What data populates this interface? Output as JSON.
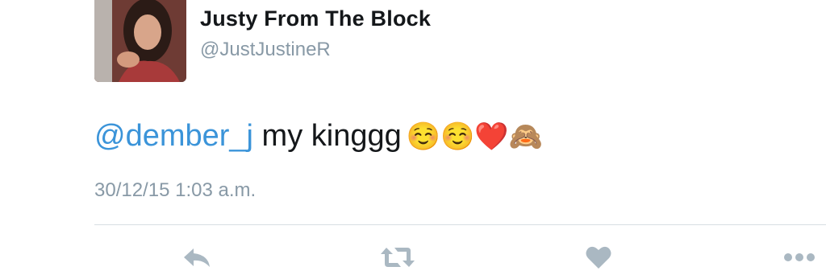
{
  "author": {
    "display_name": "Justy From The Block",
    "handle": "@JustJustineR"
  },
  "tweet": {
    "mention": "@dember_j",
    "text": " my kinggg",
    "emojis": "☺️☺️❤️🙈",
    "timestamp": "30/12/15 1:03 a.m."
  },
  "actions": {
    "icons": [
      "reply-icon",
      "retweet-icon",
      "like-icon",
      "more-icon"
    ]
  },
  "colors": {
    "mention": "#3b94d9",
    "secondary_text": "#8899a6",
    "icon": "#aab8c2"
  }
}
